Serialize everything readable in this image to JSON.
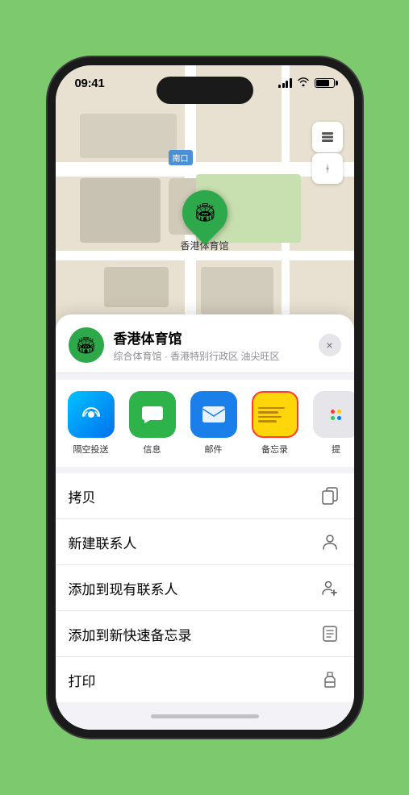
{
  "status_bar": {
    "time": "09:41",
    "location_arrow": "▶"
  },
  "map": {
    "label_nankou": "南口",
    "location_name": "香港体育馆",
    "location_pin_emoji": "🏟"
  },
  "map_controls": {
    "layers_icon": "🗺",
    "compass_icon": "↑"
  },
  "venue": {
    "name": "香港体育馆",
    "subtitle": "综合体育馆 · 香港特别行政区 油尖旺区",
    "icon_emoji": "🏟"
  },
  "share_items": [
    {
      "id": "airdrop",
      "label": "隔空投送",
      "icon": "📡"
    },
    {
      "id": "message",
      "label": "信息",
      "icon": "💬"
    },
    {
      "id": "mail",
      "label": "邮件",
      "icon": "✉"
    },
    {
      "id": "notes",
      "label": "备忘录",
      "icon": ""
    },
    {
      "id": "more",
      "label": "提",
      "icon": "···"
    }
  ],
  "actions": [
    {
      "id": "copy",
      "label": "拷贝",
      "icon": "copy"
    },
    {
      "id": "new-contact",
      "label": "新建联系人",
      "icon": "person"
    },
    {
      "id": "add-existing",
      "label": "添加到现有联系人",
      "icon": "person-plus"
    },
    {
      "id": "add-notes",
      "label": "添加到新快速备忘录",
      "icon": "note"
    },
    {
      "id": "print",
      "label": "打印",
      "icon": "print"
    }
  ],
  "close_button": "×"
}
